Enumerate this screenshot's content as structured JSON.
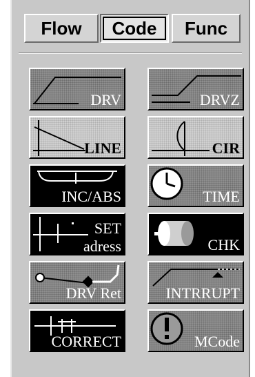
{
  "tabs": [
    {
      "label": "Flow"
    },
    {
      "label": "Code"
    },
    {
      "label": "Func"
    }
  ],
  "active_tab": "Code",
  "buttons": {
    "drv": "DRV",
    "drvz": "DRVZ",
    "line": "LINE",
    "cir": "CIR",
    "inc_abs": "INC/ABS",
    "time": "TIME",
    "set_top": "SET",
    "set_bottom": "adress",
    "chk": "CHK",
    "drv_ret": "DRV Ret",
    "intrrupt": "INTRRUPT",
    "correct": "CORRECT",
    "mcode": "MCode"
  }
}
